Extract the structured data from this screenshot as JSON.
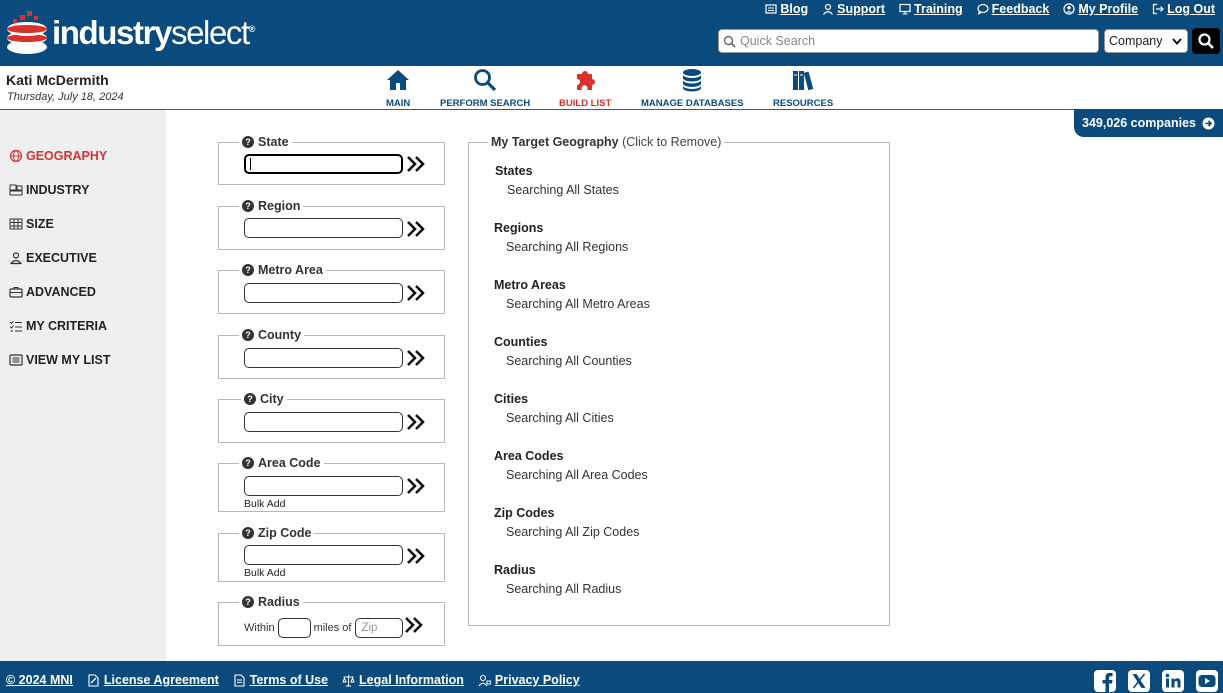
{
  "header": {
    "logo_bold": "industry",
    "logo_light": "select",
    "logo_reg": "®",
    "links": [
      {
        "label": "Blog",
        "icon": "blog-icon"
      },
      {
        "label": "Support",
        "icon": "support-icon"
      },
      {
        "label": "Training",
        "icon": "training-icon"
      },
      {
        "label": "Feedback",
        "icon": "feedback-icon"
      },
      {
        "label": "My Profile",
        "icon": "profile-icon"
      },
      {
        "label": "Log Out",
        "icon": "logout-icon"
      }
    ],
    "search_placeholder": "Quick Search",
    "search_type": "Company"
  },
  "user": {
    "name": "Kati McDermith",
    "date": "Thursday, July 18, 2024"
  },
  "nav": [
    {
      "label": "MAIN",
      "icon": "home-icon"
    },
    {
      "label": "PERFORM SEARCH",
      "icon": "magnifier-icon"
    },
    {
      "label": "BUILD LIST",
      "icon": "puzzle-icon",
      "active": true
    },
    {
      "label": "MANAGE DATABASES",
      "icon": "database-icon"
    },
    {
      "label": "RESOURCES",
      "icon": "books-icon"
    }
  ],
  "company_count": "349,026 companies",
  "sidebar": {
    "items": [
      {
        "label": "GEOGRAPHY",
        "icon": "globe-icon",
        "active": true
      },
      {
        "label": "INDUSTRY",
        "icon": "industry-icon"
      },
      {
        "label": "SIZE",
        "icon": "size-grid-icon"
      },
      {
        "label": "EXECUTIVE",
        "icon": "person-icon"
      },
      {
        "label": "ADVANCED",
        "icon": "briefcase-icon"
      },
      {
        "label": "MY CRITERIA",
        "icon": "checklist-icon"
      },
      {
        "label": "VIEW MY LIST",
        "icon": "list-icon"
      }
    ]
  },
  "geo_fields": {
    "state": "State",
    "region": "Region",
    "metro": "Metro Area",
    "county": "County",
    "city": "City",
    "area_code": "Area Code",
    "zip": "Zip Code",
    "radius": "Radius",
    "bulk_add": "Bulk Add",
    "radius_within": "Within",
    "radius_miles_of": "miles of",
    "radius_zip_placeholder": "Zip",
    "help_glyph": "?"
  },
  "target": {
    "legend_title": "My Target Geography",
    "legend_note": "(Click to Remove)",
    "sections": [
      {
        "heading": "States",
        "value": "Searching All States"
      },
      {
        "heading": "Regions",
        "value": "Searching All Regions"
      },
      {
        "heading": "Metro Areas",
        "value": "Searching All Metro Areas"
      },
      {
        "heading": "Counties",
        "value": "Searching All Counties"
      },
      {
        "heading": "Cities",
        "value": "Searching All Cities"
      },
      {
        "heading": "Area Codes",
        "value": "Searching All Area Codes"
      },
      {
        "heading": "Zip Codes",
        "value": "Searching All Zip Codes"
      },
      {
        "heading": "Radius",
        "value": "Searching All Radius"
      }
    ]
  },
  "footer": {
    "links": [
      {
        "label": "© 2024 MNI"
      },
      {
        "label": "License Agreement",
        "icon": "license-icon"
      },
      {
        "label": "Terms of Use",
        "icon": "document-icon"
      },
      {
        "label": "Legal Information",
        "icon": "scales-icon"
      },
      {
        "label": "Privacy Policy",
        "icon": "privacy-icon"
      }
    ],
    "social": [
      "facebook-icon",
      "x-icon",
      "linkedin-icon",
      "youtube-icon"
    ]
  },
  "colors": {
    "brand_blue": "#0b4a7c",
    "accent_red": "#d9312b",
    "sidebar_bg": "#efefef"
  }
}
